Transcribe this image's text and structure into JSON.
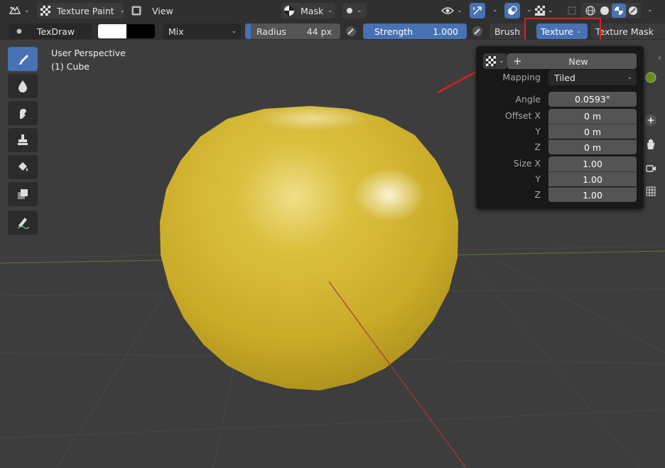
{
  "header": {
    "mode_label": "Texture Paint",
    "view_menu": "View",
    "mask_label": "Mask"
  },
  "tool_settings": {
    "brush_name": "TexDraw",
    "blend_mode": "Mix",
    "radius_label": "Radius",
    "radius_value": "44 px",
    "strength_label": "Strength",
    "strength_value": "1.000",
    "strength_fill_fraction": 1.0,
    "brush_tab": "Brush",
    "texture_tab": "Texture",
    "texture_mask_tab": "Texture Mask"
  },
  "viewport": {
    "perspective_label": "User Perspective",
    "object_label": "(1) Cube"
  },
  "texture_popup": {
    "new_button": "New",
    "mapping_label": "Mapping",
    "mapping_value": "Tiled",
    "angle_label": "Angle",
    "angle_value": "0.0593°",
    "offset_x_label": "Offset X",
    "offset_x_value": "0 m",
    "offset_y_label": "Y",
    "offset_y_value": "0 m",
    "offset_z_label": "Z",
    "offset_z_value": "0 m",
    "size_x_label": "Size X",
    "size_x_value": "1.00",
    "size_y_label": "Y",
    "size_y_value": "1.00",
    "size_z_label": "Z",
    "size_z_value": "1.00"
  },
  "colors": {
    "accent": "#4772b3",
    "highlight": "#e01e1e",
    "sphere": "#d2b42c",
    "background": "#3d3d3d"
  }
}
